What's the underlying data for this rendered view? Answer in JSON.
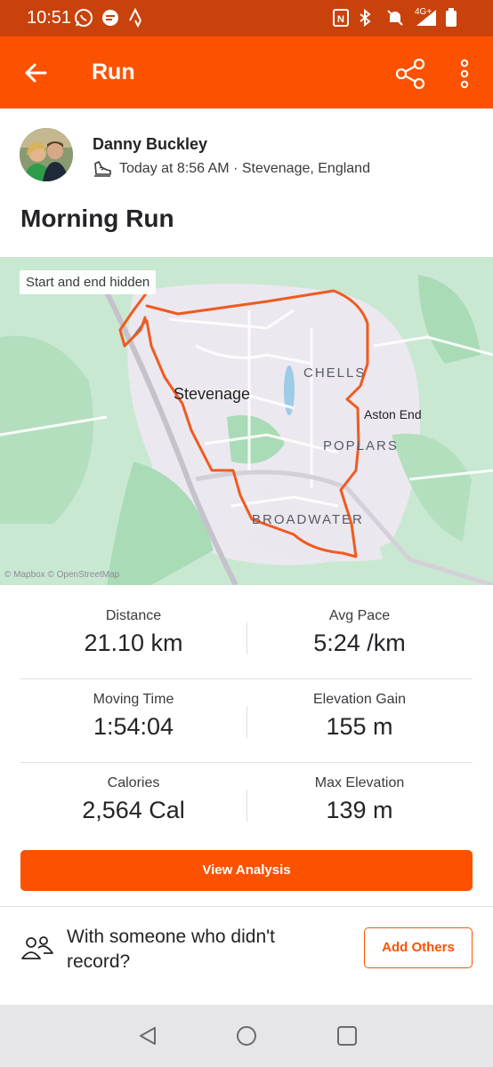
{
  "status_bar": {
    "time": "10:51",
    "network": "4G+",
    "icons": [
      "whatsapp-icon",
      "chat-icon",
      "strava-icon",
      "nfc-icon",
      "bluetooth-icon",
      "vibrate-icon",
      "mute-icon",
      "signal-icon",
      "battery-icon"
    ]
  },
  "top_bar": {
    "title": "Run",
    "icons": [
      "back-arrow-icon",
      "share-icon",
      "more-icon"
    ],
    "accent": "#fc5200"
  },
  "athlete": {
    "name": "Danny Buckley",
    "meta": "Today at 8:56 AM · Stevenage, England",
    "meta_icon": "shoe-icon"
  },
  "activity": {
    "title": "Morning Run"
  },
  "map": {
    "badge": "Start and end hidden",
    "places": {
      "town": "Stevenage",
      "chells": "CHELLS",
      "aston_end": "Aston End",
      "poplars": "POPLARS",
      "broadwater": "BROADWATER"
    },
    "attribution": "© Mapbox © OpenStreetMap",
    "route_color": "#f05a1f"
  },
  "stats": [
    {
      "left": {
        "label": "Distance",
        "value": "21.10 km"
      },
      "right": {
        "label": "Avg Pace",
        "value": "5:24 /km"
      }
    },
    {
      "left": {
        "label": "Moving Time",
        "value": "1:54:04"
      },
      "right": {
        "label": "Elevation Gain",
        "value": "155 m"
      }
    },
    {
      "left": {
        "label": "Calories",
        "value": "2,564 Cal"
      },
      "right": {
        "label": "Max Elevation",
        "value": "139 m"
      }
    }
  ],
  "actions": {
    "view_analysis": "View Analysis",
    "others_text": "With someone who didn't record?",
    "add_others": "Add Others"
  },
  "nav_bar": {
    "icons": [
      "back-triangle-icon",
      "home-circle-icon",
      "recents-square-icon"
    ]
  }
}
